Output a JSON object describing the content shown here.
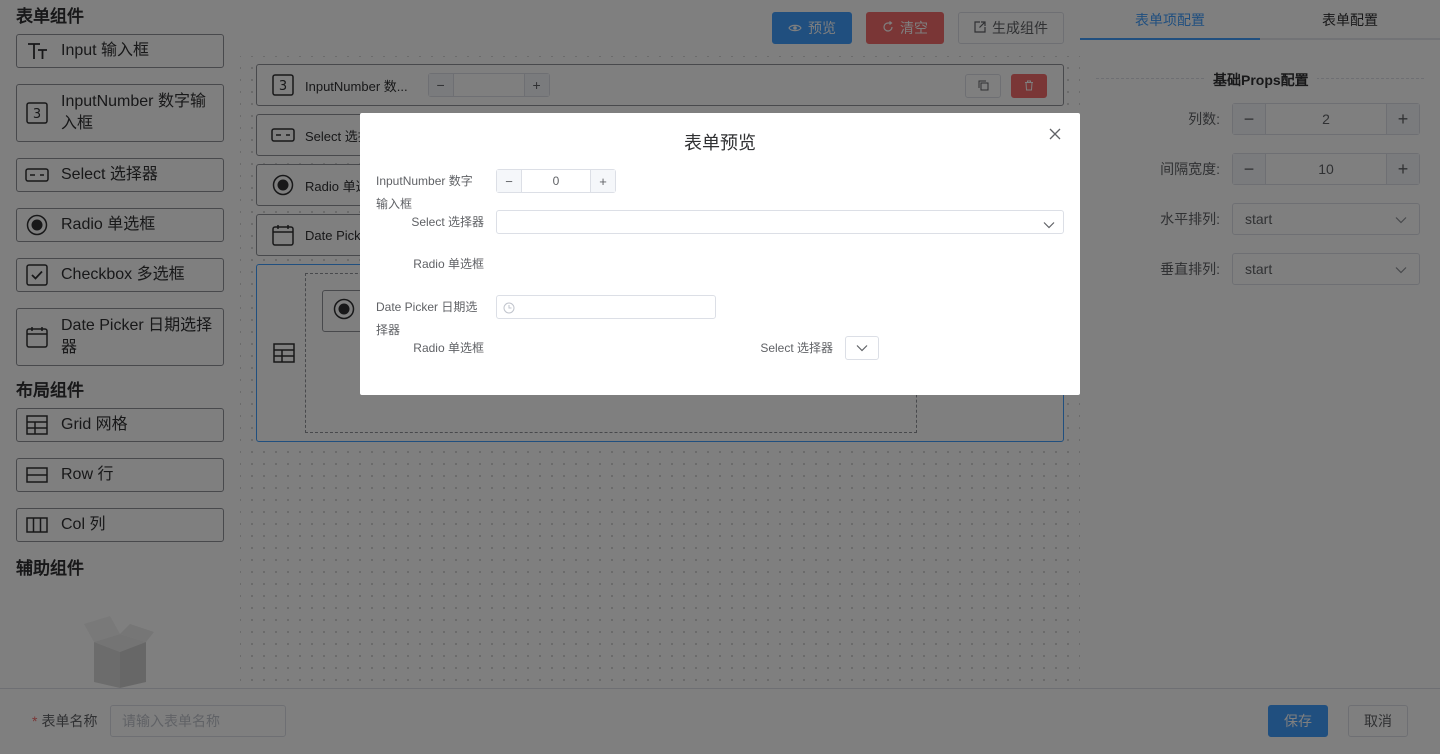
{
  "palette": {
    "form_section_title": "表单组件",
    "layout_section_title": "布局组件",
    "aux_section_title": "辅助组件",
    "form_items": [
      {
        "label": "Input 输入框",
        "icon": "text-icon"
      },
      {
        "label": "InputNumber 数字输入框",
        "icon": "number-icon"
      },
      {
        "label": "Select 选择器",
        "icon": "select-icon"
      },
      {
        "label": "Radio 单选框",
        "icon": "radio-icon"
      },
      {
        "label": "Checkbox 多选框",
        "icon": "checkbox-icon"
      },
      {
        "label": "Date Picker 日期选择器",
        "icon": "calendar-icon"
      }
    ],
    "layout_items": [
      {
        "label": "Grid 网格",
        "icon": "grid-icon"
      },
      {
        "label": "Row 行",
        "icon": "row-icon"
      },
      {
        "label": "Col 列",
        "icon": "col-icon"
      }
    ]
  },
  "toolbar": {
    "preview_label": "预览",
    "clear_label": "清空",
    "generate_label": "生成组件"
  },
  "canvas": {
    "items": [
      {
        "label": "InputNumber 数..."
      },
      {
        "label": "Select 选择"
      },
      {
        "label": "Radio 单选"
      },
      {
        "label": "Date Picke"
      }
    ]
  },
  "right_panel": {
    "tabs": [
      "表单项配置",
      "表单配置"
    ],
    "active_tab": 0,
    "section_title": "基础Props配置",
    "columns_label": "列数:",
    "columns_value": "2",
    "gutter_label": "间隔宽度:",
    "gutter_value": "10",
    "justify_label": "水平排列:",
    "justify_value": "start",
    "align_label": "垂直排列:",
    "align_value": "start"
  },
  "footer": {
    "name_label": "表单名称",
    "name_placeholder": "请输入表单名称",
    "save_label": "保存",
    "cancel_label": "取消"
  },
  "dialog": {
    "title": "表单预览",
    "inputnumber_label_line1": "InputNumber 数字",
    "inputnumber_label_line2": "输入框",
    "inputnumber_value": "0",
    "select_label": "Select 选择器",
    "radio_label": "Radio 单选框",
    "datepicker_label_line1": "Date Picker 日期选",
    "datepicker_label_line2": "择器",
    "grid_radio_label": "Radio 单选框",
    "grid_select_label": "Select 选择器"
  },
  "colors": {
    "primary": "#409eff",
    "danger": "#f56c6c",
    "mask": "rgba(0,0,0,0.5)"
  }
}
